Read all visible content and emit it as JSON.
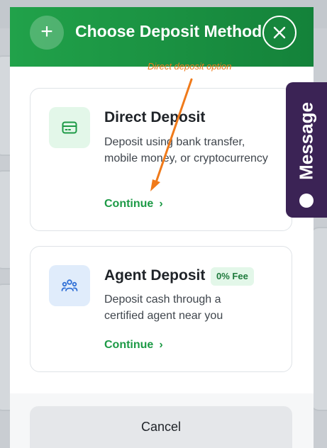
{
  "header": {
    "title": "Choose Deposit Method"
  },
  "annotation": {
    "text": "Direct deposit option"
  },
  "options": [
    {
      "title": "Direct Deposit",
      "description": "Deposit using bank transfer, mobile money, or cryptocurrency",
      "action": "Continue",
      "icon": "credit-card-icon"
    },
    {
      "title": "Agent Deposit",
      "badge": "0% Fee",
      "description": "Deposit cash through a certified agent near you",
      "action": "Continue",
      "icon": "users-group-icon"
    }
  ],
  "footer": {
    "cancel_label": "Cancel"
  },
  "message_tab": {
    "label": "Message"
  },
  "colors": {
    "header_green": "#1a9440",
    "accent_green": "#1d9a46",
    "annotation_orange": "#f07a1a",
    "message_tab_purple": "#3b2355"
  }
}
